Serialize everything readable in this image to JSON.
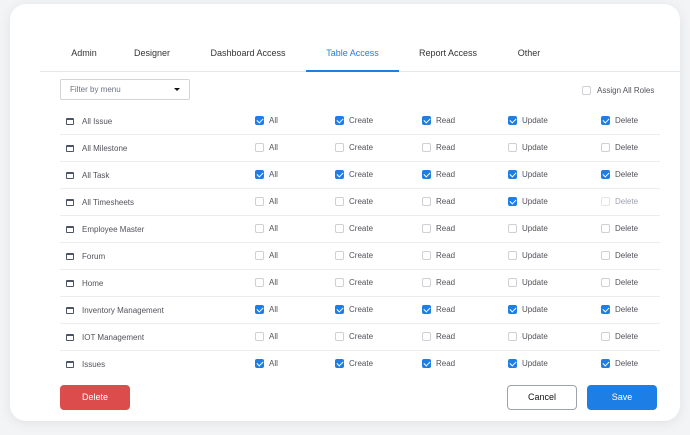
{
  "tabs": [
    {
      "label": "Admin",
      "active": false
    },
    {
      "label": "Designer",
      "active": false
    },
    {
      "label": "Dashboard Access",
      "active": false
    },
    {
      "label": "Table Access",
      "active": true
    },
    {
      "label": "Report Access",
      "active": false
    },
    {
      "label": "Other",
      "active": false
    }
  ],
  "filter": {
    "placeholder": "Filter by menu"
  },
  "assign_all_roles": {
    "label": "Assign All Roles",
    "checked": false
  },
  "permission_labels": [
    "All",
    "Create",
    "Read",
    "Update",
    "Delete"
  ],
  "rows": [
    {
      "name": "All Issue",
      "perms": [
        true,
        true,
        true,
        true,
        true
      ]
    },
    {
      "name": "All Milestone",
      "perms": [
        false,
        false,
        false,
        false,
        false
      ]
    },
    {
      "name": "All Task",
      "perms": [
        true,
        true,
        true,
        true,
        true
      ]
    },
    {
      "name": "All Timesheets",
      "perms": [
        false,
        false,
        false,
        true,
        false
      ],
      "delete_disabled": true
    },
    {
      "name": "Employee Master",
      "perms": [
        false,
        false,
        false,
        false,
        false
      ]
    },
    {
      "name": "Forum",
      "perms": [
        false,
        false,
        false,
        false,
        false
      ]
    },
    {
      "name": "Home",
      "perms": [
        false,
        false,
        false,
        false,
        false
      ]
    },
    {
      "name": "Inventory Management",
      "perms": [
        true,
        true,
        true,
        true,
        true
      ]
    },
    {
      "name": "IOT Management",
      "perms": [
        false,
        false,
        false,
        false,
        false
      ]
    },
    {
      "name": "Issues",
      "perms": [
        true,
        true,
        true,
        true,
        true
      ]
    }
  ],
  "buttons": {
    "delete": "Delete",
    "cancel": "Cancel",
    "save": "Save"
  },
  "colors": {
    "accent": "#1d7fe6",
    "danger": "#dc4c4c"
  }
}
